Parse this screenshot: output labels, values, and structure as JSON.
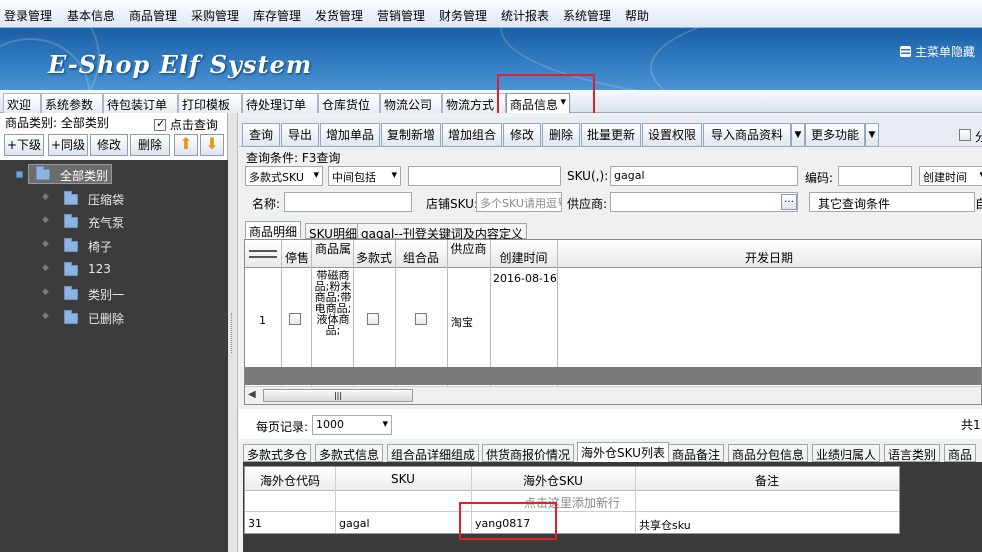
{
  "menu": [
    "登录管理",
    "基本信息",
    "商品管理",
    "采购管理",
    "库存管理",
    "发货管理",
    "营销管理",
    "财务管理",
    "统计报表",
    "系统管理",
    "帮助"
  ],
  "banner": {
    "logo": "E-Shop Elf System",
    "hide_menu": "主菜单隐藏"
  },
  "tabs": [
    "欢迎",
    "系统参数",
    "待包装订单",
    "打印模板",
    "待处理订单",
    "仓库货位",
    "物流公司",
    "物流方式",
    "商品信息"
  ],
  "left": {
    "category_label": "商品类别: 全部类别",
    "click_query": "点击查询",
    "buttons": [
      "+下级",
      "+同级",
      "修改",
      "删除"
    ],
    "tree_root": "全部类别",
    "tree_items": [
      "压缩袋",
      "充气泵",
      "椅子",
      "123",
      "类别一",
      "已删除"
    ]
  },
  "toolbar": {
    "buttons": [
      "查询",
      "导出",
      "增加单品",
      "复制新增",
      "增加组合",
      "修改",
      "删除",
      "批量更新",
      "设置权限",
      "导入商品资料",
      "更多功能"
    ],
    "truncated": "分"
  },
  "query": {
    "title": "查询条件: F3查询",
    "multi_sku_select": "多款式SKU",
    "middle_select": "中间包括",
    "sku_label": "SKU(,):",
    "sku_value": "gagal",
    "code_label": "编码:",
    "create_time_select": "创建时间",
    "name_label": "名称:",
    "shop_sku_label": "店铺SKU:",
    "shop_sku_placeholder": "多个SKU请用逗号",
    "supplier_label": "供应商:",
    "other_conditions": "其它查询条件",
    "truncated": "自"
  },
  "result_tabs": [
    "商品明细",
    "SKU明细",
    "gagal--刊登关键词及内容定义"
  ],
  "main_table": {
    "headers": [
      "停售",
      "商品属",
      "多款式",
      "组合品",
      "供应商",
      "创建时间",
      "开发日期"
    ],
    "row": {
      "index": "1",
      "attributes": "带磁商品;粉末商品;带电商品;液体商品;",
      "supplier": "淘宝",
      "created": "2016-08-16"
    }
  },
  "paging": {
    "label": "每页记录:",
    "value": "1000",
    "total_prefix": "共1"
  },
  "bottom_tabs": [
    "多款式多仓",
    "多款式信息",
    "组合品详细组成",
    "供货商报价情况",
    "海外仓SKU列表",
    "商品备注",
    "商品分包信息",
    "业绩归属人",
    "语言类别",
    "商品"
  ],
  "overseas_table": {
    "headers": [
      "海外仓代码",
      "SKU",
      "海外仓SKU",
      "备注"
    ],
    "add_row": "点击这里添加新行",
    "row": [
      "31",
      "gagal",
      "yang0817",
      "共享仓sku"
    ]
  },
  "colors": {
    "annotation": "#e0212b",
    "banner": "#2e77bd"
  }
}
